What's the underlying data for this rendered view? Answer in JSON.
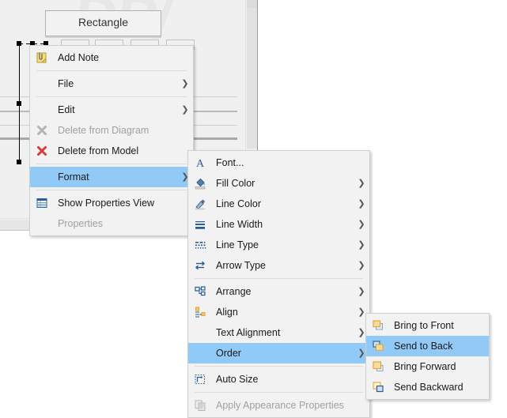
{
  "canvas": {
    "shape_label": "Rectangle",
    "watermark_text": "DP/",
    "tabs": [
      {
        "name": "tab-1"
      },
      {
        "name": "tab-2"
      },
      {
        "name": "tab-3"
      },
      {
        "name": "tab-4"
      }
    ]
  },
  "menu_main": {
    "name": "context-menu",
    "items": [
      {
        "label": "Add Note",
        "icon": "note-icon",
        "submenu": false,
        "disabled": false,
        "highlight": false,
        "sep_after": true
      },
      {
        "label": "File",
        "icon": "",
        "submenu": true,
        "disabled": false,
        "highlight": false,
        "sep_after": true
      },
      {
        "label": "Edit",
        "icon": "",
        "submenu": true,
        "disabled": false,
        "highlight": false,
        "sep_after": false
      },
      {
        "label": "Delete from Diagram",
        "icon": "delete-gray-icon",
        "submenu": false,
        "disabled": true,
        "highlight": false,
        "sep_after": false
      },
      {
        "label": "Delete from Model",
        "icon": "delete-red-icon",
        "submenu": false,
        "disabled": false,
        "highlight": false,
        "sep_after": true
      },
      {
        "label": "Format",
        "icon": "",
        "submenu": true,
        "disabled": false,
        "highlight": true,
        "sep_after": true
      },
      {
        "label": "Show Properties View",
        "icon": "properties-view-icon",
        "submenu": false,
        "disabled": false,
        "highlight": false,
        "sep_after": false
      },
      {
        "label": "Properties",
        "icon": "",
        "submenu": false,
        "disabled": true,
        "highlight": false,
        "sep_after": false
      }
    ]
  },
  "menu_format": {
    "name": "format-submenu",
    "items": [
      {
        "label": "Font...",
        "icon": "font-icon",
        "submenu": false,
        "disabled": false,
        "highlight": false,
        "sep_after": false
      },
      {
        "label": "Fill Color",
        "icon": "fill-color-icon",
        "submenu": true,
        "disabled": false,
        "highlight": false,
        "sep_after": false
      },
      {
        "label": "Line Color",
        "icon": "line-color-icon",
        "submenu": true,
        "disabled": false,
        "highlight": false,
        "sep_after": false
      },
      {
        "label": "Line Width",
        "icon": "line-width-icon",
        "submenu": true,
        "disabled": false,
        "highlight": false,
        "sep_after": false
      },
      {
        "label": "Line Type",
        "icon": "line-type-icon",
        "submenu": true,
        "disabled": false,
        "highlight": false,
        "sep_after": false
      },
      {
        "label": "Arrow Type",
        "icon": "arrow-type-icon",
        "submenu": true,
        "disabled": false,
        "highlight": false,
        "sep_after": true
      },
      {
        "label": "Arrange",
        "icon": "arrange-icon",
        "submenu": true,
        "disabled": false,
        "highlight": false,
        "sep_after": false
      },
      {
        "label": "Align",
        "icon": "align-icon",
        "submenu": true,
        "disabled": false,
        "highlight": false,
        "sep_after": false
      },
      {
        "label": "Text Alignment",
        "icon": "",
        "submenu": true,
        "disabled": false,
        "highlight": false,
        "sep_after": false
      },
      {
        "label": "Order",
        "icon": "",
        "submenu": true,
        "disabled": false,
        "highlight": true,
        "sep_after": true
      },
      {
        "label": "Auto Size",
        "icon": "auto-size-icon",
        "submenu": false,
        "disabled": false,
        "highlight": false,
        "sep_after": true
      },
      {
        "label": "Apply Appearance Properties",
        "icon": "apply-appearance-icon",
        "submenu": false,
        "disabled": true,
        "highlight": false,
        "sep_after": false
      }
    ]
  },
  "menu_order": {
    "name": "order-submenu",
    "items": [
      {
        "label": "Bring to Front",
        "icon": "bring-to-front-icon",
        "submenu": false,
        "disabled": false,
        "highlight": false,
        "sep_after": false
      },
      {
        "label": "Send to Back",
        "icon": "send-to-back-icon",
        "submenu": false,
        "disabled": false,
        "highlight": true,
        "sep_after": false
      },
      {
        "label": "Bring Forward",
        "icon": "bring-forward-icon",
        "submenu": false,
        "disabled": false,
        "highlight": false,
        "sep_after": false
      },
      {
        "label": "Send Backward",
        "icon": "send-backward-icon",
        "submenu": false,
        "disabled": false,
        "highlight": false,
        "sep_after": false
      }
    ]
  },
  "colors": {
    "menu_background": "#f2f2f2",
    "highlight": "#91c9f7",
    "icon_blue": "#2a5d94",
    "icon_orange": "#e8a33d",
    "delete_red": "#d93a3a",
    "disabled_text": "#a0a0a0",
    "canvas_background": "#f0f0f0"
  }
}
